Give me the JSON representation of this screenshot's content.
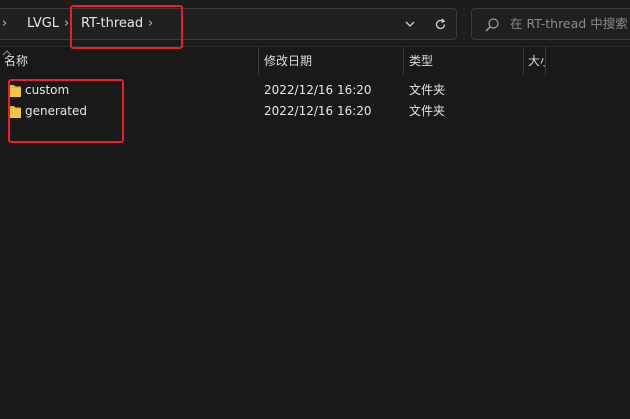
{
  "address_bar": {
    "crumbs": [
      "LVGL",
      "RT-thread"
    ],
    "dropdown_icon": "chevron-down-icon",
    "refresh_icon": "refresh-icon"
  },
  "search": {
    "placeholder": "在 RT-thread 中搜索",
    "icon": "search-icon"
  },
  "columns": {
    "name": "名称",
    "modified": "修改日期",
    "type": "类型",
    "size": "大小"
  },
  "files": [
    {
      "name": "custom",
      "modified": "2022/12/16 16:20",
      "type": "文件夹",
      "icon": "folder-icon"
    },
    {
      "name": "generated",
      "modified": "2022/12/16 16:20",
      "type": "文件夹",
      "icon": "folder-icon"
    }
  ],
  "colors": {
    "background": "#191919",
    "annotation": "#e8202a",
    "folder": "#f4c542"
  }
}
